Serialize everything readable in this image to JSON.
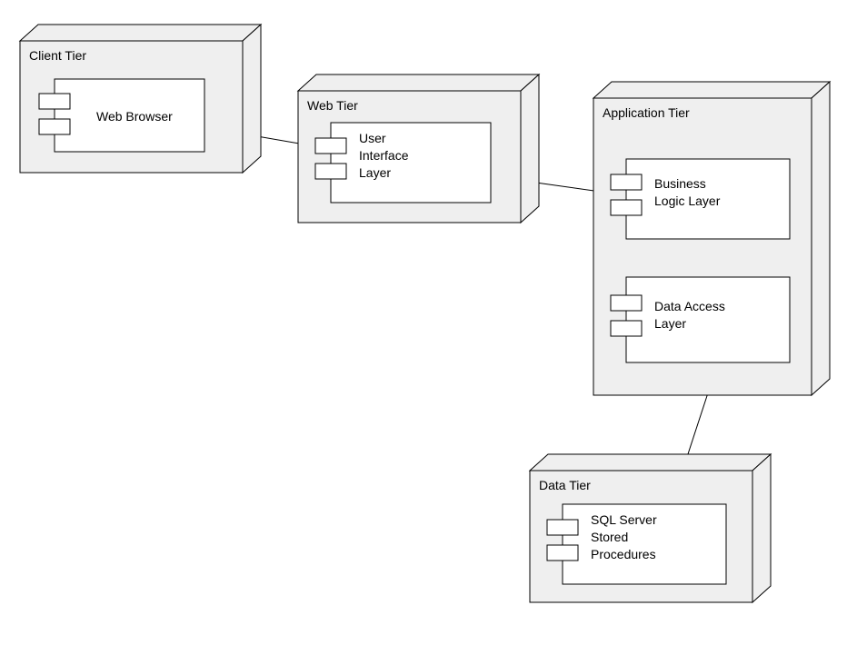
{
  "tiers": {
    "client": {
      "label": "Client Tier"
    },
    "web": {
      "label": "Web Tier"
    },
    "application": {
      "label": "Application Tier"
    },
    "data": {
      "label": "Data Tier"
    }
  },
  "components": {
    "webBrowser": {
      "label": "Web Browser"
    },
    "uiLayer": {
      "label": "User\nInterface\nLayer"
    },
    "businessLogic": {
      "label": "Business\nLogic Layer"
    },
    "dataAccess": {
      "label": "Data Access\nLayer"
    },
    "sqlServer": {
      "label": "SQL Server\nStored\nProcedures"
    }
  }
}
